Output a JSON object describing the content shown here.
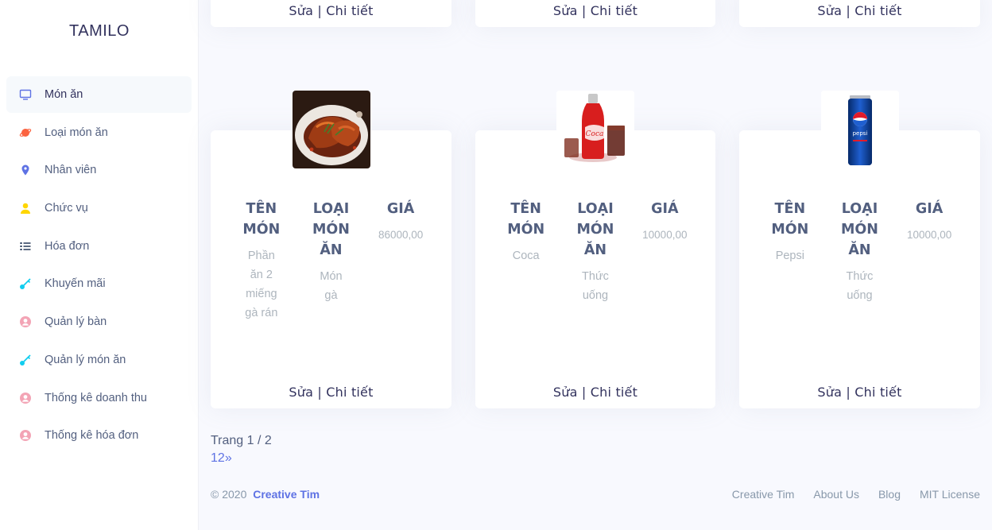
{
  "sidebar": {
    "brand": "TAMILO",
    "items": [
      {
        "label": "Món ăn",
        "icon": "tv-icon",
        "active": true
      },
      {
        "label": "Loại món ăn",
        "icon": "planet-icon"
      },
      {
        "label": "Nhân viên",
        "icon": "pin-icon"
      },
      {
        "label": "Chức vụ",
        "icon": "user-icon"
      },
      {
        "label": "Hóa đơn",
        "icon": "list-icon"
      },
      {
        "label": "Khuyến mãi",
        "icon": "key-icon"
      },
      {
        "label": "Quản lý bàn",
        "icon": "circle-user-icon"
      },
      {
        "label": "Quản lý món ăn",
        "icon": "key-icon"
      },
      {
        "label": "Thống kê doanh thu",
        "icon": "circle-user-icon"
      },
      {
        "label": "Thống kê hóa đơn",
        "icon": "circle-user-icon"
      }
    ]
  },
  "actions": {
    "edit": "Sửa",
    "sep": " | ",
    "detail": "Chi tiết"
  },
  "columns": {
    "name": [
      "TÊN",
      "MÓN"
    ],
    "type": [
      "LOẠI",
      "MÓN",
      "ĂN"
    ],
    "price": [
      "GIÁ"
    ]
  },
  "cards": [
    {
      "image": "fried-chicken-image",
      "name": [
        "Phần",
        "ăn 2",
        "miếng",
        "gà rán"
      ],
      "type": [
        "Món",
        "gà"
      ],
      "price": "86000,00"
    },
    {
      "image": "coca-cola-image",
      "name": [
        "Coca"
      ],
      "type": [
        "Thức",
        "uống"
      ],
      "price": "10000,00"
    },
    {
      "image": "pepsi-can-image",
      "name": [
        "Pepsi"
      ],
      "type": [
        "Thức",
        "uống"
      ],
      "price": "10000,00"
    }
  ],
  "pagination": {
    "label": "Trang 1 / 2",
    "pages": [
      "1",
      "2",
      "»"
    ]
  },
  "footer": {
    "copyright": "© 2020",
    "brand": "Creative Tim",
    "links": [
      "Creative Tim",
      "About Us",
      "Blog",
      "MIT License"
    ]
  },
  "colors": {
    "accent": "#5e72e4",
    "background": "#f8f9fe",
    "text": "#525f7f",
    "muted": "#adb5bd"
  }
}
